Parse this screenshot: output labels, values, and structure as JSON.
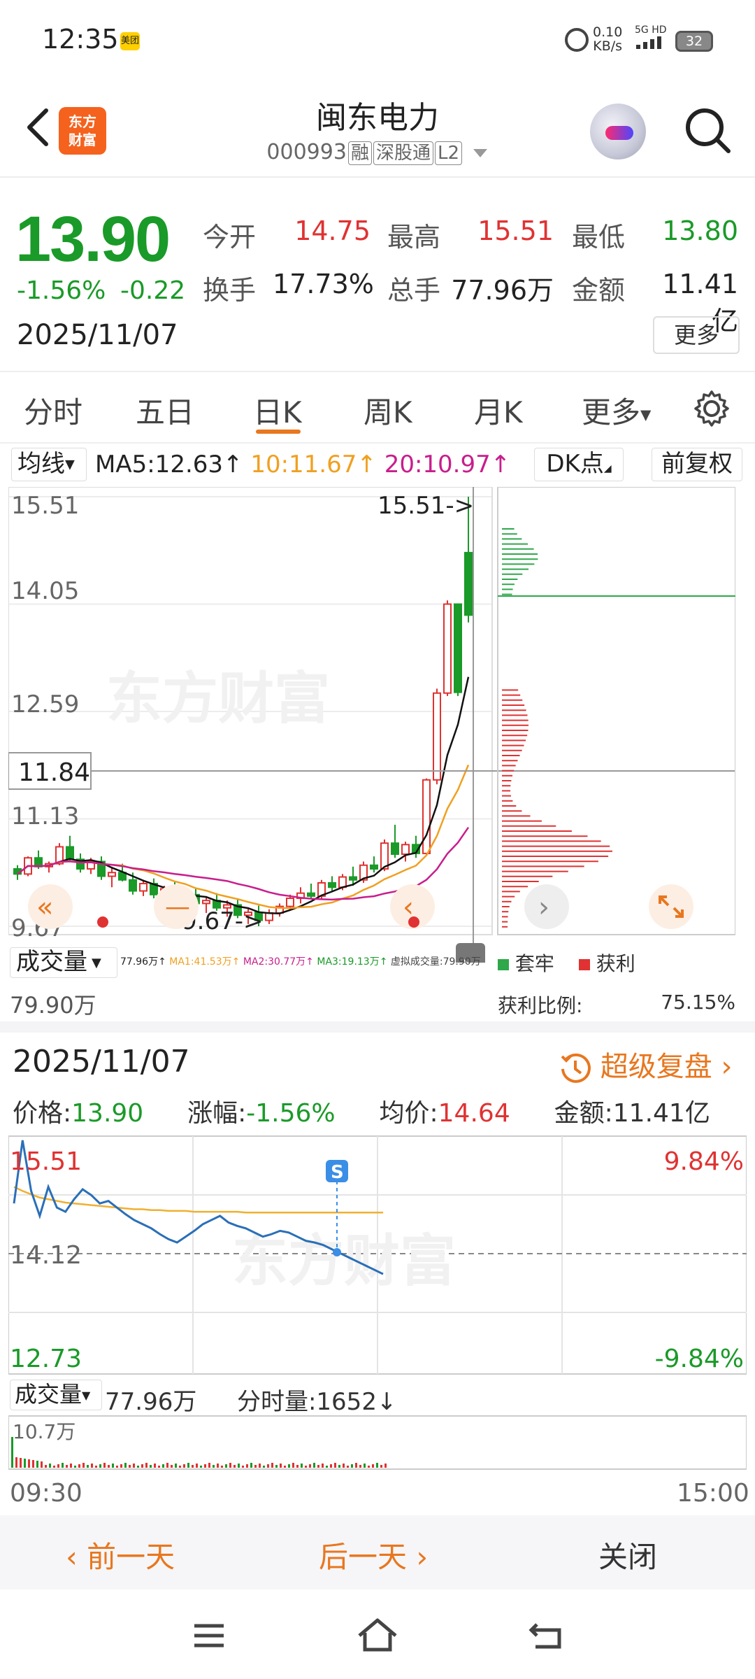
{
  "status_bar": {
    "time": "12:35",
    "app_badge": "美团",
    "net_speed_value": "0.10",
    "net_speed_unit": "KB/s",
    "network": "5G HD",
    "battery": "32"
  },
  "header": {
    "logo_text": "东方\n财富",
    "stock_name": "闽东电力",
    "stock_code": "000993",
    "tags": [
      "融",
      "深股通",
      "L2"
    ]
  },
  "quote": {
    "price": "13.90",
    "change_pct": "-1.56%",
    "change": "-0.22",
    "date": "2025/11/07",
    "fields": [
      {
        "label": "今开",
        "value": "14.75",
        "color": "#e03232"
      },
      {
        "label": "最高",
        "value": "15.51",
        "color": "#e03232"
      },
      {
        "label": "最低",
        "value": "13.80",
        "color": "#1a9a28"
      },
      {
        "label": "换手",
        "value": "17.73%",
        "color": "#222222"
      },
      {
        "label": "总手",
        "value": "77.96万",
        "color": "#222222"
      },
      {
        "label": "金额",
        "value": "11.41亿",
        "color": "#222222"
      }
    ],
    "more_label": "更多"
  },
  "tabs": {
    "items": [
      "分时",
      "五日",
      "日K",
      "周K",
      "月K",
      "更多"
    ],
    "active": "日K"
  },
  "kline": {
    "ma_selector": "均线",
    "ma5": "MA5:12.63↑",
    "ma10": "10:11.67↑",
    "ma20": "20:10.97↑",
    "dk_label": "DK点",
    "adjust_label": "前复权",
    "price_ticks": [
      "15.51",
      "14.05",
      "12.59",
      "11.13",
      "9.67"
    ],
    "current_price_label": "11.84",
    "high_marker": "15.51->",
    "low_marker": "9.67->",
    "watermark": "东方财富"
  },
  "volume": {
    "selector": "成交量",
    "vol_text": "77.96万↑",
    "ma1": "MA1:41.53万↑",
    "ma2": "MA2:30.77万↑",
    "ma3": "MA3:19.13万↑",
    "virtual": "虚拟成交量:79.90万",
    "max_label": "79.90万"
  },
  "chip": {
    "legend_trapped": "套牢",
    "legend_profit": "获利",
    "profit_ratio_label": "获利比例:",
    "profit_ratio_value": "75.15%"
  },
  "intraday": {
    "date": "2025/11/07",
    "super_review": "超级复盘",
    "price_label": "价格:",
    "price": "13.90",
    "change_label": "涨幅:",
    "change": "-1.56%",
    "avg_label": "均价:",
    "avg": "14.64",
    "amount_label": "金额:",
    "amount": "11.41亿",
    "top_price": "15.51",
    "mid_price": "14.12",
    "bottom_price": "12.73",
    "top_pct": "9.84%",
    "bottom_pct": "-9.84%",
    "s_marker": "S",
    "vol_selector": "成交量",
    "vol_total": "77.96万",
    "tick_vol": "分时量:1652↓",
    "vol_max": "10.7万",
    "time_start": "09:30",
    "time_end": "15:00",
    "watermark": "东方财富"
  },
  "actions": {
    "prev_day": "前一天",
    "next_day": "后一天",
    "close": "关闭"
  },
  "chart_data": {
    "type": "candlestick",
    "title": "",
    "ylim": [
      9.67,
      15.51
    ],
    "yticks": [
      15.51,
      14.05,
      12.59,
      11.13,
      9.67
    ],
    "ma_colors": {
      "MA5": "#111111",
      "MA10": "#f0a020",
      "MA20": "#c81e8c"
    },
    "candles": [
      [
        10.45,
        10.5,
        10.3,
        10.38
      ],
      [
        10.38,
        10.62,
        10.35,
        10.6
      ],
      [
        10.6,
        10.7,
        10.45,
        10.48
      ],
      [
        10.48,
        10.55,
        10.4,
        10.52
      ],
      [
        10.52,
        10.8,
        10.5,
        10.75
      ],
      [
        10.75,
        10.9,
        10.55,
        10.58
      ],
      [
        10.58,
        10.66,
        10.4,
        10.45
      ],
      [
        10.45,
        10.6,
        10.38,
        10.55
      ],
      [
        10.55,
        10.62,
        10.3,
        10.35
      ],
      [
        10.35,
        10.48,
        10.2,
        10.4
      ],
      [
        10.4,
        10.52,
        10.28,
        10.3
      ],
      [
        10.3,
        10.4,
        10.1,
        10.15
      ],
      [
        10.15,
        10.3,
        10.08,
        10.25
      ],
      [
        10.25,
        10.32,
        10.05,
        10.1
      ],
      [
        10.1,
        10.22,
        9.98,
        10.18
      ],
      [
        10.18,
        10.28,
        10.02,
        10.06
      ],
      [
        10.06,
        10.15,
        9.95,
        10.1
      ],
      [
        10.1,
        10.18,
        9.92,
        9.98
      ],
      [
        9.98,
        10.08,
        9.85,
        10.02
      ],
      [
        10.02,
        10.12,
        9.88,
        9.92
      ],
      [
        9.92,
        10.02,
        9.8,
        9.96
      ],
      [
        9.96,
        10.05,
        9.78,
        9.82
      ],
      [
        9.82,
        9.92,
        9.7,
        9.86
      ],
      [
        9.86,
        9.95,
        9.67,
        9.75
      ],
      [
        9.75,
        9.9,
        9.7,
        9.85
      ],
      [
        9.85,
        9.98,
        9.8,
        9.94
      ],
      [
        9.94,
        10.1,
        9.88,
        10.05
      ],
      [
        10.05,
        10.2,
        9.98,
        10.12
      ],
      [
        10.12,
        10.25,
        10.05,
        10.08
      ],
      [
        10.08,
        10.3,
        10.04,
        10.26
      ],
      [
        10.26,
        10.35,
        10.15,
        10.2
      ],
      [
        10.2,
        10.38,
        10.16,
        10.34
      ],
      [
        10.34,
        10.48,
        10.22,
        10.3
      ],
      [
        10.3,
        10.55,
        10.26,
        10.5
      ],
      [
        10.5,
        10.62,
        10.4,
        10.45
      ],
      [
        10.45,
        10.85,
        10.42,
        10.8
      ],
      [
        10.8,
        11.05,
        10.6,
        10.65
      ],
      [
        10.65,
        10.82,
        10.55,
        10.78
      ],
      [
        10.78,
        10.9,
        10.6,
        10.66
      ],
      [
        10.66,
        11.68,
        10.64,
        11.66
      ],
      [
        11.66,
        12.9,
        11.6,
        12.84
      ],
      [
        12.84,
        14.1,
        12.8,
        14.05
      ],
      [
        14.05,
        14.05,
        12.8,
        12.85
      ],
      [
        14.75,
        15.51,
        13.8,
        13.9
      ]
    ],
    "chip_distribution": "price-volume profile: green (trapped) above current price, red (profit) below",
    "intraday": {
      "type": "line",
      "x_range": [
        "09:30",
        "15:00"
      ],
      "ylim": [
        12.73,
        15.51
      ],
      "prev_close": 14.12,
      "price_series": [
        14.75,
        15.51,
        14.9,
        14.6,
        14.95,
        14.7,
        14.65,
        14.8,
        14.92,
        14.85,
        14.75,
        14.78,
        14.7,
        14.62,
        14.55,
        14.5,
        14.45,
        14.38,
        14.32,
        14.28,
        14.35,
        14.42,
        14.5,
        14.55,
        14.6,
        14.52,
        14.48,
        14.45,
        14.4,
        14.35,
        14.38,
        14.42,
        14.4,
        14.35,
        14.3,
        14.28,
        14.25,
        14.2,
        14.15,
        14.1,
        14.05,
        14.0,
        13.95,
        13.9
      ],
      "avg_series": [
        14.95,
        14.9,
        14.86,
        14.82,
        14.8,
        14.78,
        14.76,
        14.75,
        14.74,
        14.73,
        14.72,
        14.71,
        14.7,
        14.69,
        14.68,
        14.68,
        14.67,
        14.67,
        14.66,
        14.66,
        14.66,
        14.65,
        14.65,
        14.65,
        14.65,
        14.65,
        14.65,
        14.64,
        14.64,
        14.64,
        14.64,
        14.64,
        14.64,
        14.64,
        14.64,
        14.64,
        14.64,
        14.64,
        14.64,
        14.64,
        14.64,
        14.64,
        14.64,
        14.64
      ]
    }
  }
}
